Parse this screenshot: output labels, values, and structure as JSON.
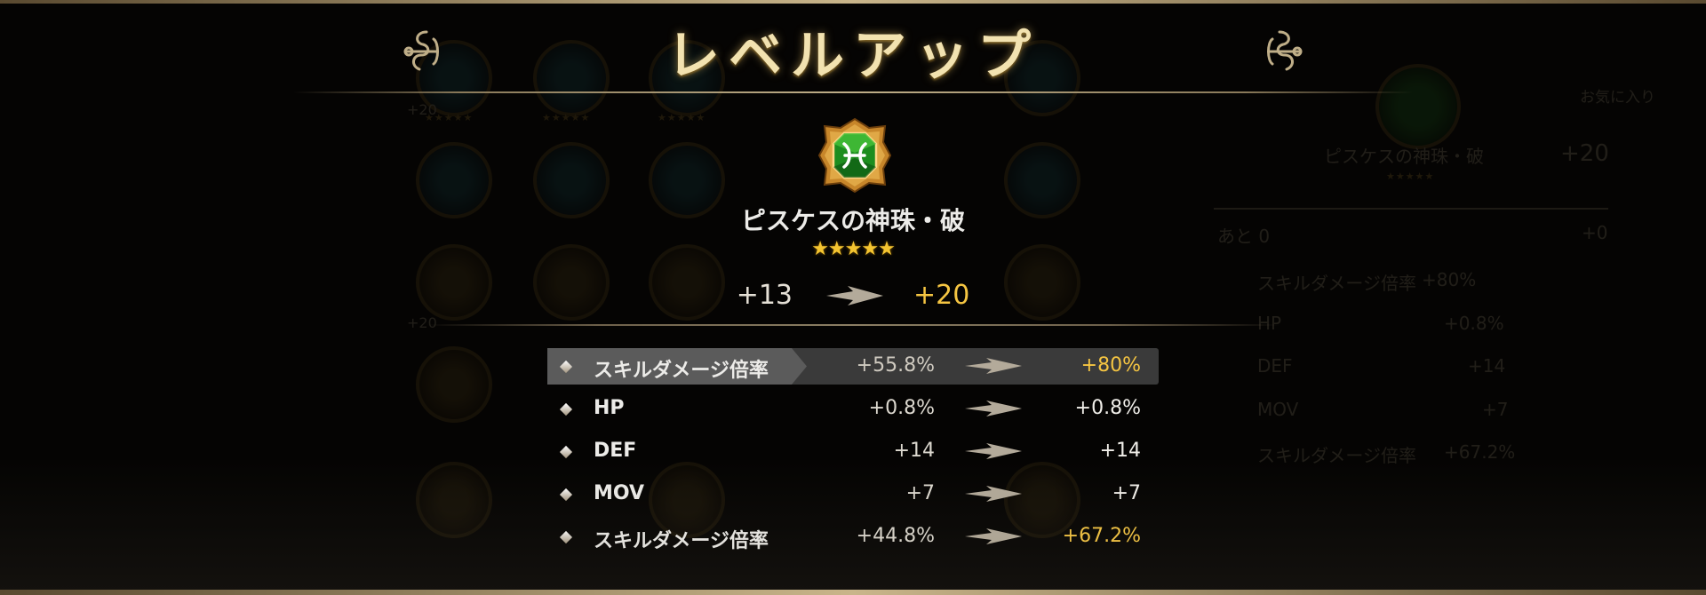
{
  "title": "レベルアップ",
  "item": {
    "name": "ピスケスの神珠・破",
    "stars": "★★★★★",
    "level_from": "+13",
    "level_to": "+20"
  },
  "stats": [
    {
      "label": "スキルダメージ倍率",
      "from": "+55.8%",
      "to": "+80%",
      "changed": true
    },
    {
      "label": "HP",
      "from": "+0.8%",
      "to": "+0.8%",
      "changed": false
    },
    {
      "label": "DEF",
      "from": "+14",
      "to": "+14",
      "changed": false
    },
    {
      "label": "MOV",
      "from": "+7",
      "to": "+7",
      "changed": false
    },
    {
      "label": "スキルダメージ倍率",
      "from": "+44.8%",
      "to": "+67.2%",
      "changed": true
    }
  ],
  "background": {
    "favorite_label": "お気に入り",
    "panel_item_name": "ピスケスの神珠・破",
    "panel_level": "+20",
    "remaining_label": "あと 0",
    "remaining_value": "+0",
    "panel_stats": [
      {
        "label": "スキルダメージ倍率",
        "value": "+80%"
      },
      {
        "label": "HP",
        "value": "+0.8%"
      },
      {
        "label": "DEF",
        "value": "+14"
      },
      {
        "label": "MOV",
        "value": "+7"
      },
      {
        "label": "スキルダメージ倍率",
        "value": "+67.2%"
      }
    ],
    "grid_level_a": "+20",
    "grid_level_b": "+20",
    "grid_level_c": "+20"
  },
  "colors": {
    "accent_gold": "#f5c542",
    "text_white": "#ecebe8",
    "highlight_row": "#3a3a3a",
    "title": "#f2e2b0"
  }
}
